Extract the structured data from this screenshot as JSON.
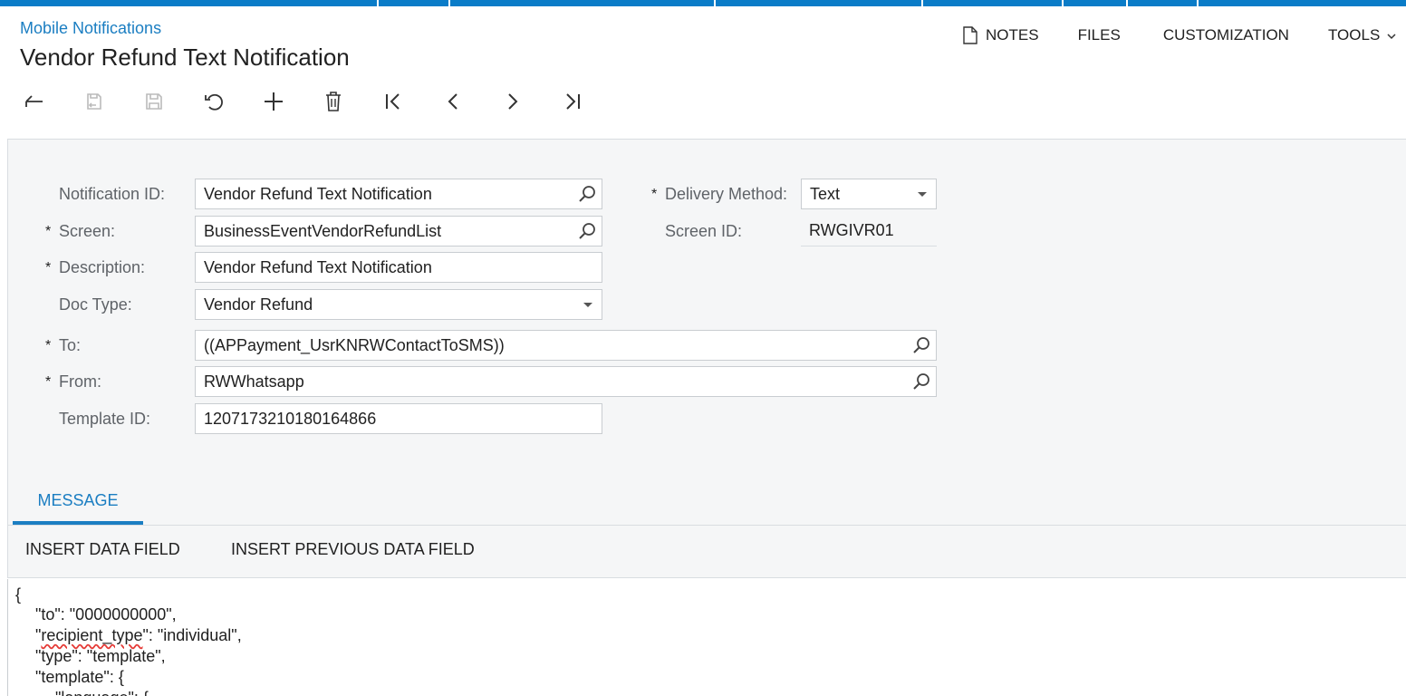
{
  "header": {
    "breadcrumb": "Mobile Notifications",
    "title": "Vendor Refund Text Notification"
  },
  "top_actions": {
    "notes": "NOTES",
    "files": "FILES",
    "customization": "CUSTOMIZATION",
    "tools": "TOOLS"
  },
  "toolbar": {
    "icons": [
      "back-icon",
      "save-close-icon",
      "save-icon",
      "undo-icon",
      "add-icon",
      "delete-icon",
      "first-record-icon",
      "previous-record-icon",
      "next-record-icon",
      "last-record-icon"
    ]
  },
  "form": {
    "notification_id": {
      "label": "Notification ID:",
      "value": "Vendor Refund Text Notification"
    },
    "screen": {
      "label": "Screen:",
      "value": "BusinessEventVendorRefundList",
      "required_mark": "*"
    },
    "description": {
      "label": "Description:",
      "value": "Vendor Refund Text Notification",
      "required_mark": "*"
    },
    "doc_type": {
      "label": "Doc Type:",
      "value": "Vendor Refund"
    },
    "to": {
      "label": "To:",
      "value": "((APPayment_UsrKNRWContactToSMS))",
      "required_mark": "*"
    },
    "from": {
      "label": "From:",
      "value": "RWWhatsapp",
      "required_mark": "*"
    },
    "template_id": {
      "label": "Template ID:",
      "value": "1207173210180164866"
    },
    "delivery_method": {
      "label": "Delivery Method:",
      "value": "Text",
      "required_mark": "*"
    },
    "screen_id": {
      "label": "Screen ID:",
      "value": "RWGIVR01"
    }
  },
  "tabs": {
    "message": "MESSAGE"
  },
  "message_toolbar": {
    "insert_data_field": "INSERT DATA FIELD",
    "insert_previous_data_field": "INSERT PREVIOUS DATA FIELD"
  },
  "editor": {
    "line1": "{",
    "line2": "\"to\": \"0000000000\",",
    "line3_quote": "\"",
    "line3_word": "recipient_type",
    "line3_rest": "\": \"individual\",",
    "line4": "\"type\": \"template\",",
    "line5": "\"template\": {",
    "line6": "\"language\": {"
  },
  "colors": {
    "accent": "#1b7ec2",
    "topbar": "#0a7cc8",
    "form_bg": "#f5f6f7"
  }
}
